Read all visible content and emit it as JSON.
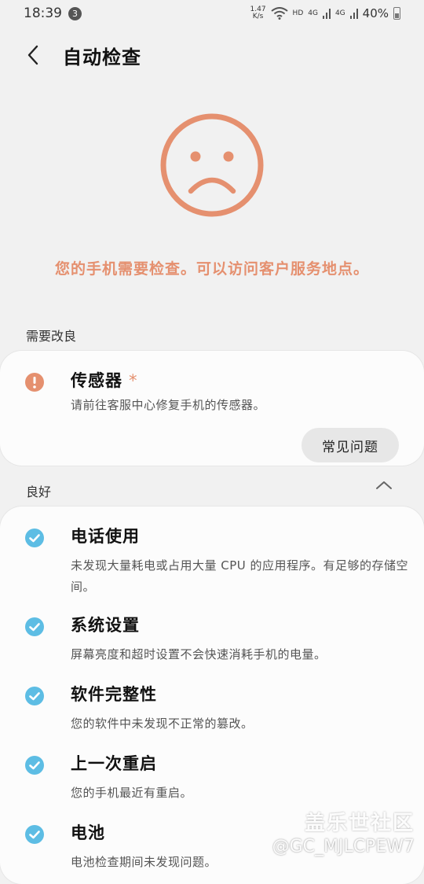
{
  "status_bar": {
    "time": "18:39",
    "notification_count": "3",
    "net_speed_value": "1.47",
    "net_speed_unit": "K/s",
    "hd_label": "HD",
    "net1": "4G",
    "net2": "4G",
    "battery": "40%"
  },
  "header": {
    "title": "自动检查"
  },
  "message": "您的手机需要检查。可以访问客户服务地点。",
  "needs_improvement": {
    "label": "需要改良",
    "item": {
      "name": "传感器",
      "star": "*",
      "desc": "请前往客服中心修复手机的传感器。",
      "button": "常见问题"
    }
  },
  "good": {
    "label": "良好",
    "items": [
      {
        "name": "电话使用",
        "desc": "未发现大量耗电或占用大量 CPU 的应用程序。有足够的存储空间。"
      },
      {
        "name": "系统设置",
        "desc": "屏幕亮度和超时设置不会快速消耗手机的电量。"
      },
      {
        "name": "软件完整性",
        "desc": "您的软件中未发现不正常的篡改。"
      },
      {
        "name": "上一次重启",
        "desc": "您的手机最近有重启。"
      },
      {
        "name": "电池",
        "desc": "电池检查期间未发现问题。"
      }
    ]
  },
  "watermark": {
    "line1": "盖乐世社区",
    "line2": "@GC_MJLCPEW7"
  },
  "colors": {
    "warning": "#e5906f",
    "check": "#5dbde4",
    "background": "#f1f1f1"
  }
}
